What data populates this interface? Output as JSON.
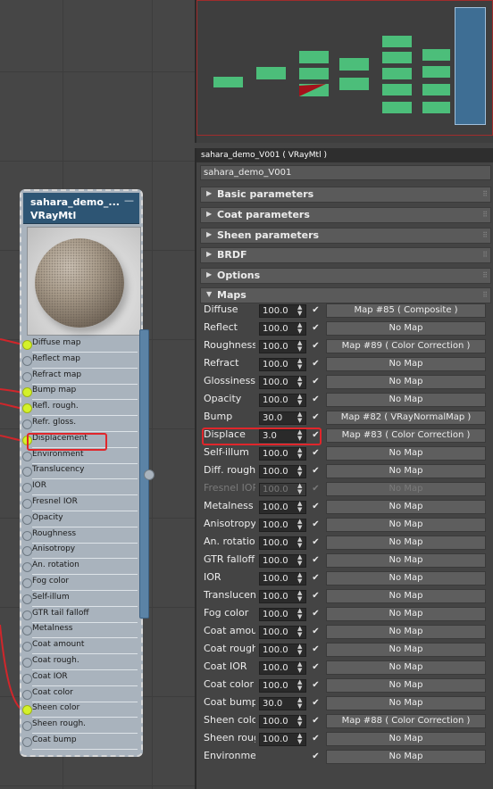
{
  "node": {
    "title": "sahara_demo_...",
    "type": "VRayMtl",
    "minimize": "—",
    "slots": [
      {
        "label": "Diffuse map",
        "connected": true
      },
      {
        "label": "Reflect map",
        "connected": false
      },
      {
        "label": "Refract map",
        "connected": false
      },
      {
        "label": "Bump map",
        "connected": true
      },
      {
        "label": "Refl. rough.",
        "connected": true
      },
      {
        "label": "Refr. gloss.",
        "connected": false
      },
      {
        "label": "Displacement",
        "connected": true
      },
      {
        "label": "Environment",
        "connected": false
      },
      {
        "label": "Translucency",
        "connected": false
      },
      {
        "label": "IOR",
        "connected": false
      },
      {
        "label": "Fresnel IOR",
        "connected": false
      },
      {
        "label": "Opacity",
        "connected": false
      },
      {
        "label": "Roughness",
        "connected": false
      },
      {
        "label": "Anisotropy",
        "connected": false
      },
      {
        "label": "An. rotation",
        "connected": false
      },
      {
        "label": "Fog color",
        "connected": false
      },
      {
        "label": "Self-illum",
        "connected": false
      },
      {
        "label": "GTR tail falloff",
        "connected": false
      },
      {
        "label": "Metalness",
        "connected": false
      },
      {
        "label": "Coat amount",
        "connected": false
      },
      {
        "label": "Coat rough.",
        "connected": false
      },
      {
        "label": "Coat IOR",
        "connected": false
      },
      {
        "label": "Coat color",
        "connected": false
      },
      {
        "label": "Sheen color",
        "connected": true
      },
      {
        "label": "Sheen rough.",
        "connected": false
      },
      {
        "label": "Coat bump",
        "connected": false
      }
    ]
  },
  "panel": {
    "title": "sahara_demo_V001  ( VRayMtl )",
    "material_name": "sahara_demo_V001",
    "rollouts": [
      {
        "label": "Basic parameters",
        "expanded": false
      },
      {
        "label": "Coat parameters",
        "expanded": false
      },
      {
        "label": "Sheen parameters",
        "expanded": false
      },
      {
        "label": "BRDF",
        "expanded": false
      },
      {
        "label": "Options",
        "expanded": false
      },
      {
        "label": "Maps",
        "expanded": true
      }
    ],
    "maps": [
      {
        "name": "Diffuse",
        "amount": "100.0",
        "checked": true,
        "map": "Map #85  ( Composite )"
      },
      {
        "name": "Reflect",
        "amount": "100.0",
        "checked": true,
        "map": "No Map"
      },
      {
        "name": "Roughness",
        "amount": "100.0",
        "checked": true,
        "map": "Map #89  ( Color Correction )"
      },
      {
        "name": "Refract",
        "amount": "100.0",
        "checked": true,
        "map": "No Map"
      },
      {
        "name": "Glossiness",
        "amount": "100.0",
        "checked": true,
        "map": "No Map"
      },
      {
        "name": "Opacity",
        "amount": "100.0",
        "checked": true,
        "map": "No Map"
      },
      {
        "name": "Bump",
        "amount": "30.0",
        "checked": true,
        "map": "Map #82  ( VRayNormalMap )"
      },
      {
        "name": "Displace",
        "amount": "3.0",
        "checked": true,
        "map": "Map #83  ( Color Correction )"
      },
      {
        "name": "Self-illum",
        "amount": "100.0",
        "checked": true,
        "map": "No Map"
      },
      {
        "name": "Diff. rough.",
        "amount": "100.0",
        "checked": true,
        "map": "No Map"
      },
      {
        "name": "Fresnel IOR",
        "amount": "100.0",
        "checked": true,
        "map": "No Map",
        "disabled": true
      },
      {
        "name": "Metalness",
        "amount": "100.0",
        "checked": true,
        "map": "No Map"
      },
      {
        "name": "Anisotropy",
        "amount": "100.0",
        "checked": true,
        "map": "No Map"
      },
      {
        "name": "An. rotation",
        "amount": "100.0",
        "checked": true,
        "map": "No Map"
      },
      {
        "name": "GTR falloff",
        "amount": "100.0",
        "checked": true,
        "map": "No Map"
      },
      {
        "name": "IOR",
        "amount": "100.0",
        "checked": true,
        "map": "No Map"
      },
      {
        "name": "Translucent",
        "amount": "100.0",
        "checked": true,
        "map": "No Map"
      },
      {
        "name": "Fog color",
        "amount": "100.0",
        "checked": true,
        "map": "No Map"
      },
      {
        "name": "Coat amoun",
        "amount": "100.0",
        "checked": true,
        "map": "No Map"
      },
      {
        "name": "Coat rough",
        "amount": "100.0",
        "checked": true,
        "map": "No Map"
      },
      {
        "name": "Coat IOR",
        "amount": "100.0",
        "checked": true,
        "map": "No Map"
      },
      {
        "name": "Coat color",
        "amount": "100.0",
        "checked": true,
        "map": "No Map"
      },
      {
        "name": "Coat bump",
        "amount": "30.0",
        "checked": true,
        "map": "No Map"
      },
      {
        "name": "Sheen color",
        "amount": "100.0",
        "checked": true,
        "map": "Map #88  ( Color Correction )"
      },
      {
        "name": "Sheen rougl",
        "amount": "100.0",
        "checked": true,
        "map": "No Map"
      },
      {
        "name": "Environment",
        "amount": "",
        "checked": true,
        "map": "No Map"
      }
    ],
    "check_glyph": "✔",
    "spinner_glyph": "▲▼",
    "arrow_collapsed": "▶",
    "arrow_expanded": "▼",
    "grip_glyph": "⠿"
  },
  "colors": {
    "highlight": "#e0262b",
    "connected_socket": "#d4f12a",
    "node_header": "#2d5574",
    "navigator_block": "#4cbe7a"
  }
}
